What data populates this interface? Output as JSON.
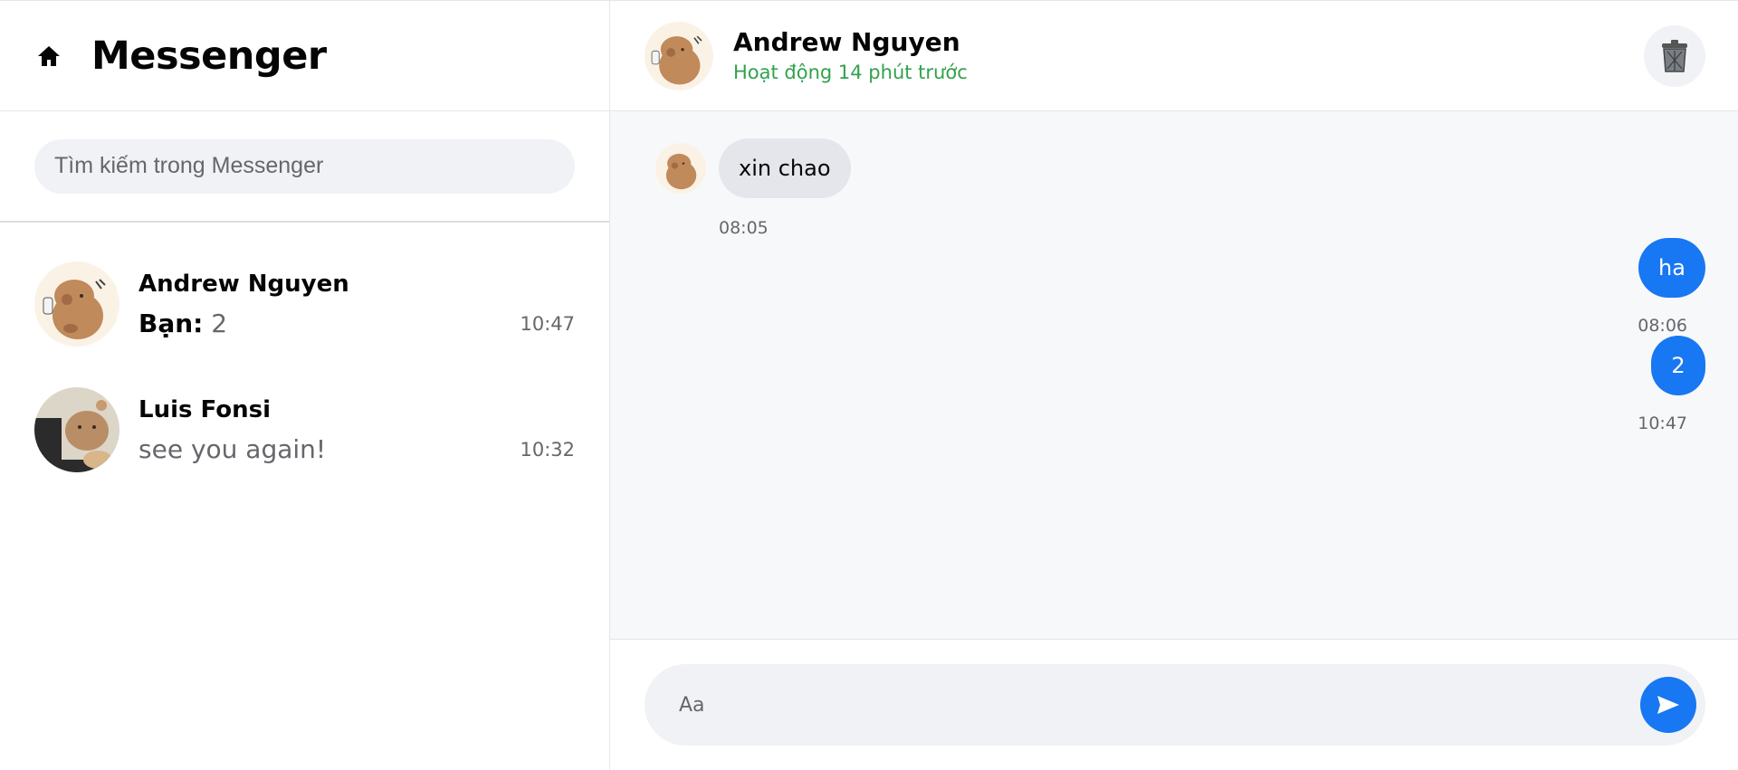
{
  "sidebar": {
    "title": "Messenger",
    "search_placeholder": "Tìm kiếm trong Messenger",
    "conversations": [
      {
        "name": "Andrew Nguyen",
        "prefix": "Bạn:",
        "preview": " 2",
        "time": "10:47"
      },
      {
        "name": "Luis Fonsi",
        "prefix": "",
        "preview": "see you again!",
        "time": "10:32"
      }
    ]
  },
  "chat": {
    "name": "Andrew Nguyen",
    "status": "Hoạt động 14 phút trước",
    "messages": [
      {
        "direction": "in",
        "text": "xin chao",
        "time": "08:05"
      },
      {
        "direction": "out",
        "text": "ha",
        "time": "08:06"
      },
      {
        "direction": "out",
        "text": "2",
        "time": "10:47"
      }
    ],
    "composer_placeholder": "Aa"
  },
  "colors": {
    "accent": "#1877f2",
    "online": "#31a24c",
    "bubble_in": "#e4e6eb"
  },
  "icons": {
    "home": "home-icon",
    "trash": "trash-icon",
    "send": "send-icon"
  }
}
